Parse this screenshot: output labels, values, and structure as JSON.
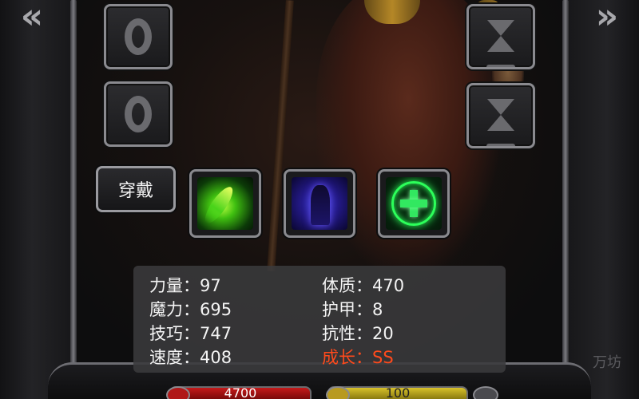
{
  "navigation": {
    "prev_label": "«",
    "next_label": "»"
  },
  "equipment": {
    "left_slots": [
      {
        "icon": "ring-icon"
      },
      {
        "icon": "ring-icon"
      }
    ],
    "right_slots": [
      {
        "icon": "hourglass-icon"
      },
      {
        "icon": "hourglass-icon"
      }
    ],
    "wear_button_label": "穿戴"
  },
  "skills": [
    {
      "icon": "green-slash-skill-icon",
      "color": "#49d41a"
    },
    {
      "icon": "shadow-figure-skill-icon",
      "color": "#3a3acf"
    },
    {
      "icon": "heal-cross-skill-icon",
      "color": "#2cff5a"
    }
  ],
  "stats": {
    "left": [
      {
        "label": "力量",
        "value": "97"
      },
      {
        "label": "魔力",
        "value": "695"
      },
      {
        "label": "技巧",
        "value": "747"
      },
      {
        "label": "速度",
        "value": "408"
      }
    ],
    "right": [
      {
        "label": "体质",
        "value": "470"
      },
      {
        "label": "护甲",
        "value": "8"
      },
      {
        "label": "抗性",
        "value": "20"
      },
      {
        "label": "成长",
        "value": "SS"
      }
    ],
    "separator": "：",
    "growth_color": "#ff4a1c"
  },
  "bottom_bars": {
    "hp_value": "4700",
    "mp_value": "100",
    "hp_color": "#c51a1a",
    "mp_color": "#d8c22a"
  },
  "side_text": "万坊"
}
